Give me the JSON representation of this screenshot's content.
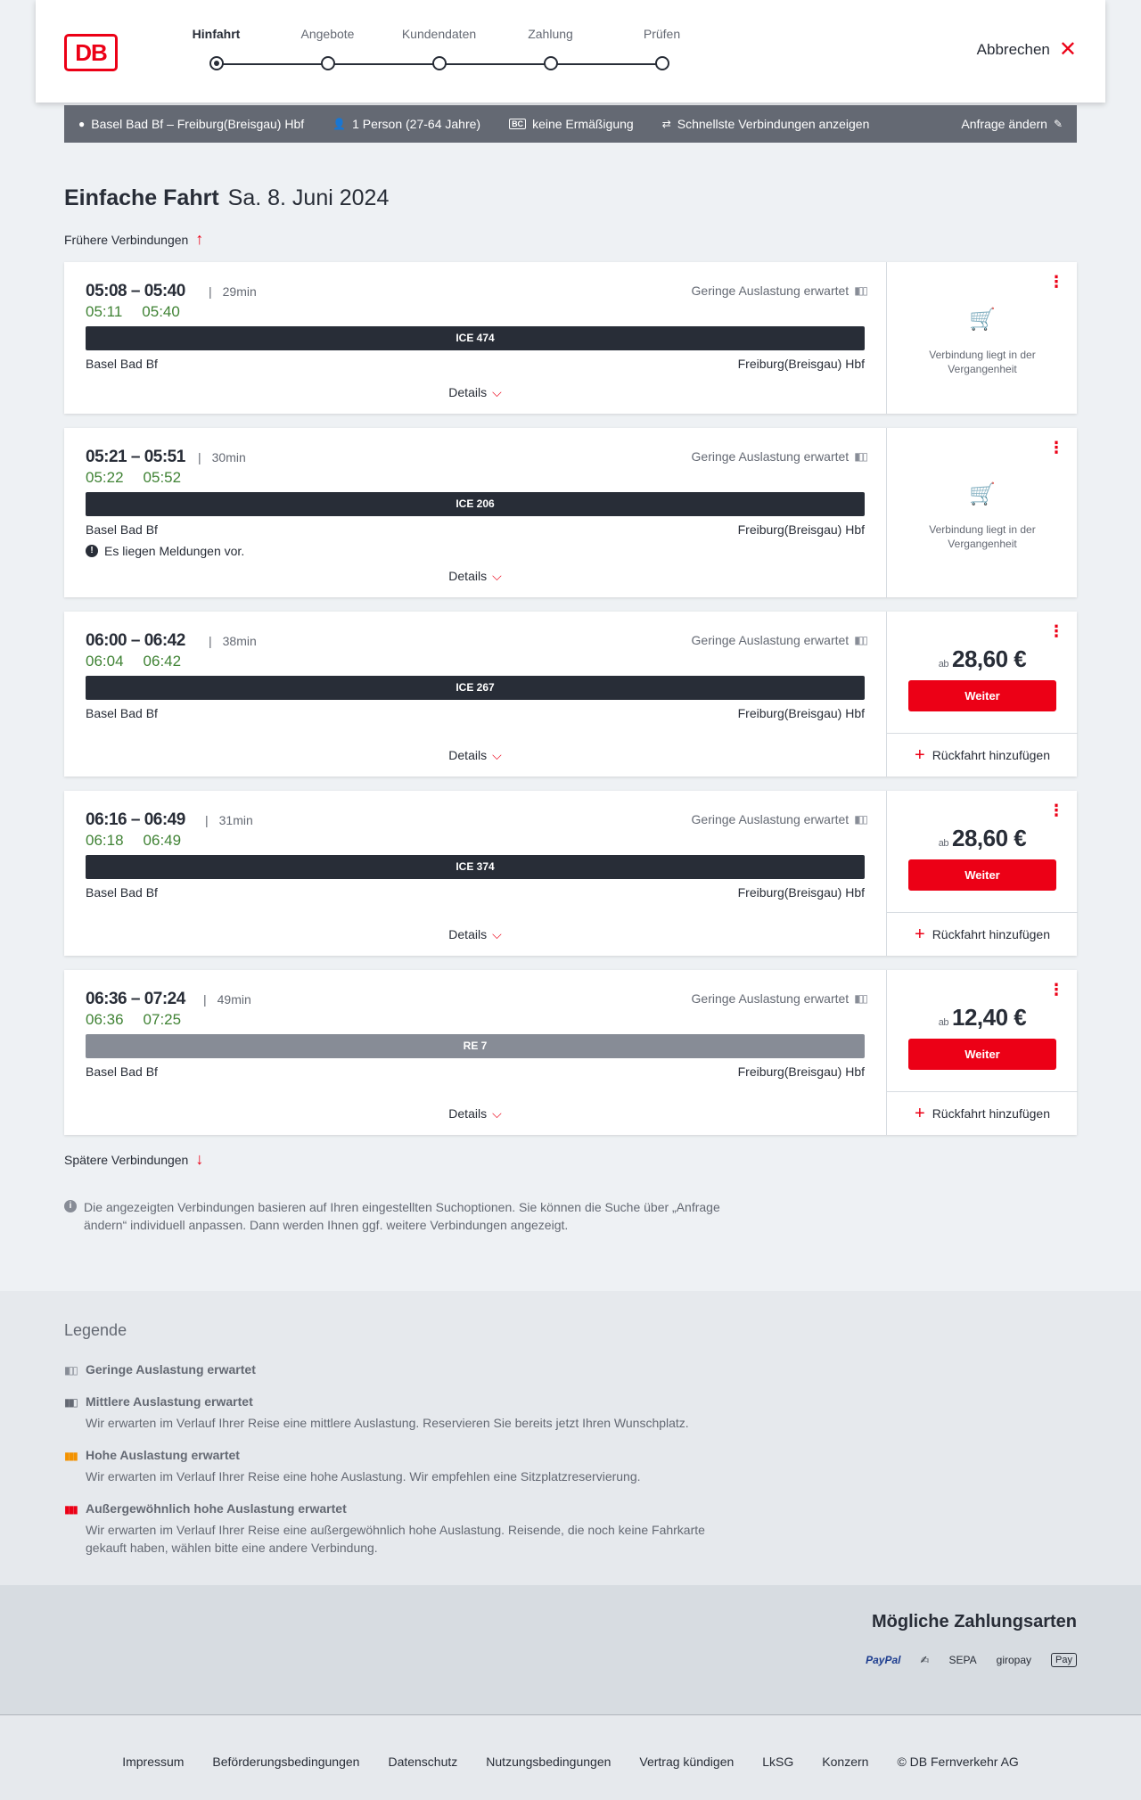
{
  "header": {
    "steps": [
      "Hinfahrt",
      "Angebote",
      "Kundendaten",
      "Zahlung",
      "Prüfen"
    ],
    "cancel_label": "Abbrechen",
    "logo": "DB"
  },
  "search": {
    "route": "Basel Bad Bf – Freiburg(Breisgau) Hbf",
    "travellers": "1 Person (27-64 Jahre)",
    "discount_badge": "BC",
    "discount": "keine Ermäßigung",
    "fastest": "Schnellste Verbindungen anzeigen",
    "change": "Anfrage ändern"
  },
  "title": {
    "bold": "Einfache Fahrt",
    "date": "Sa. 8. Juni 2024"
  },
  "earlier": "Frühere Verbindungen",
  "later": "Spätere Verbindungen",
  "connections": [
    {
      "times": "05:08 – 05:40",
      "duration": "29min",
      "rt_dep": "05:11",
      "rt_arr": "05:40",
      "occupancy": "Geringe Auslastung erwartet",
      "train": "ICE 474",
      "from": "Basel Bad Bf",
      "to": "Freiburg(Breisgau) Hbf",
      "details": "Details",
      "past": "Verbindung liegt in der Vergangenheit"
    },
    {
      "times": "05:21 – 05:51",
      "duration": "30min",
      "rt_dep": "05:22",
      "rt_arr": "05:52",
      "occupancy": "Geringe Auslastung erwartet",
      "train": "ICE 206",
      "from": "Basel Bad Bf",
      "to": "Freiburg(Breisgau) Hbf",
      "notice": "Es liegen Meldungen vor.",
      "details": "Details",
      "past": "Verbindung liegt in der Vergangenheit"
    },
    {
      "times": "06:00 – 06:42",
      "duration": "38min",
      "rt_dep": "06:04",
      "rt_arr": "06:42",
      "occupancy": "Geringe Auslastung erwartet",
      "train": "ICE 267",
      "from": "Basel Bad Bf",
      "to": "Freiburg(Breisgau) Hbf",
      "details": "Details",
      "price_prefix": "ab",
      "price": "28,60 €",
      "button": "Weiter",
      "return": "Rückfahrt hinzufügen"
    },
    {
      "times": "06:16 – 06:49",
      "duration": "31min",
      "rt_dep": "06:18",
      "rt_arr": "06:49",
      "occupancy": "Geringe Auslastung erwartet",
      "train": "ICE 374",
      "from": "Basel Bad Bf",
      "to": "Freiburg(Breisgau) Hbf",
      "details": "Details",
      "price_prefix": "ab",
      "price": "28,60 €",
      "button": "Weiter",
      "return": "Rückfahrt hinzufügen"
    },
    {
      "times": "06:36 – 07:24",
      "duration": "49min",
      "rt_dep": "06:36",
      "rt_arr": "07:25",
      "occupancy": "Geringe Auslastung erwartet",
      "train": "RE 7",
      "from": "Basel Bad Bf",
      "to": "Freiburg(Breisgau) Hbf",
      "details": "Details",
      "price_prefix": "ab",
      "price": "12,40 €",
      "button": "Weiter",
      "return": "Rückfahrt hinzufügen"
    }
  ],
  "info": "Die angezeigten Verbindungen basieren auf Ihren eingestellten Suchoptionen. Sie können die Suche über „Anfrage ändern“ individuell anpassen. Dann werden Ihnen ggf. weitere Verbindungen angezeigt.",
  "legend": {
    "title": "Legende",
    "items": [
      {
        "title": "Geringe Auslastung erwartet",
        "desc": ""
      },
      {
        "title": "Mittlere Auslastung erwartet",
        "desc": "Wir erwarten im Verlauf Ihrer Reise eine mittlere Auslastung. Reservieren Sie bereits jetzt Ihren Wunschplatz."
      },
      {
        "title": "Hohe Auslastung erwartet",
        "desc": "Wir erwarten im Verlauf Ihrer Reise eine hohe Auslastung. Wir empfehlen eine Sitzplatzreservierung."
      },
      {
        "title": "Außergewöhnlich hohe Auslastung erwartet",
        "desc": "Wir erwarten im Verlauf Ihrer Reise eine außergewöhnlich hohe Auslastung. Reisende, die noch keine Fahrkarte gekauft haben, wählen bitte eine andere Verbindung."
      }
    ]
  },
  "payment": {
    "title": "Mögliche Zahlungsarten",
    "methods": [
      "PayPal",
      "SEPA",
      "giropay",
      "Pay"
    ]
  },
  "footer": [
    "Impressum",
    "Beförderungsbedingungen",
    "Datenschutz",
    "Nutzungsbedingungen",
    "Vertrag kündigen",
    "LkSG",
    "Konzern",
    "© DB Fernverkehr AG"
  ],
  "colors": {
    "brand_red": "#ec0016",
    "realtime_green": "#408335",
    "train_bar": "#282d37",
    "re_bar": "#878c96"
  }
}
